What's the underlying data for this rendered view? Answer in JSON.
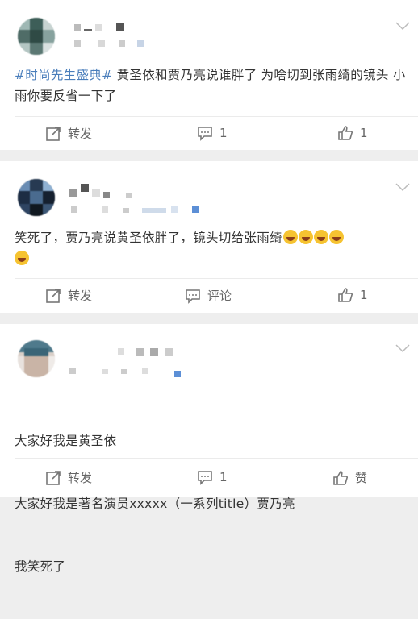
{
  "posts": [
    {
      "topic": "#时尚先生盛典#",
      "text": " 黄圣依和贾乃亮说谁胖了 为啥切到张雨绮的镜头 小雨你要反省一下了",
      "actions": {
        "repost": "转发",
        "comment": "1",
        "like": "1"
      }
    },
    {
      "text": "笑死了，贾乃亮说黄圣依胖了，镜头切给张雨绮",
      "emoji_count": 5,
      "actions": {
        "repost": "转发",
        "comment": "评论",
        "like": "1"
      }
    },
    {
      "lines": [
        "大家好我是黄圣依",
        "大家好我是著名演员xxxxx（一系列title）贾乃亮",
        "我笑死了"
      ],
      "actions": {
        "repost": "转发",
        "comment": "1",
        "like": "赞"
      }
    }
  ],
  "icons": {
    "repost": "repost-icon",
    "comment": "comment-icon",
    "like": "thumbs-up-icon",
    "menu": "chevron-down-icon",
    "emoji": "laughing-emoji-icon"
  },
  "colors": {
    "topic": "#4a7ebb",
    "text": "#333333",
    "action": "#666666",
    "background": "#eeeeee"
  }
}
